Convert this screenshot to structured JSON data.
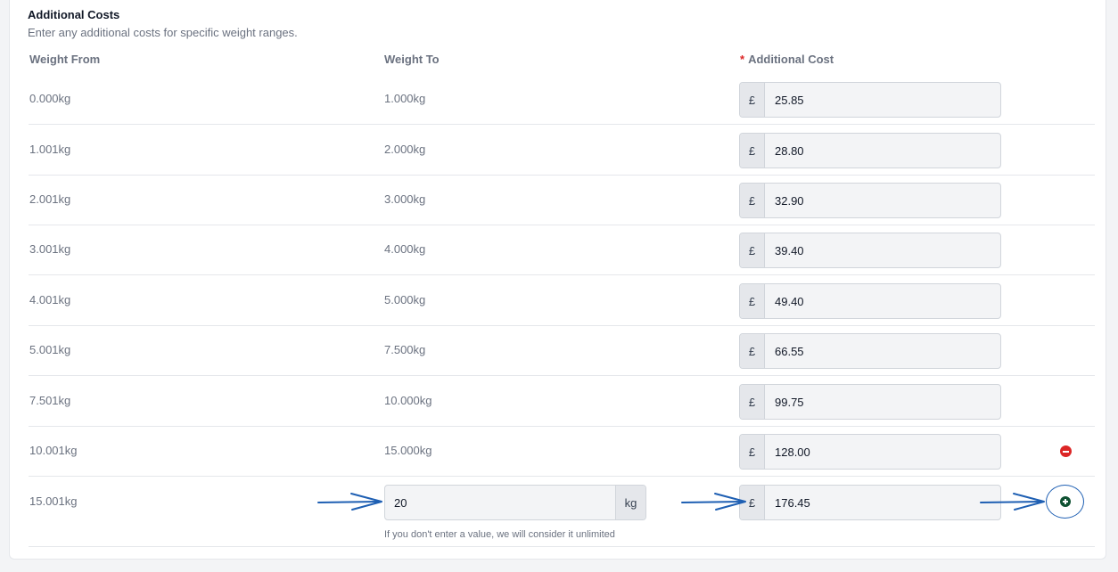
{
  "section": {
    "title": "Additional Costs",
    "subtitle": "Enter any additional costs for specific weight ranges."
  },
  "columns": {
    "weight_from": "Weight From",
    "weight_to": "Weight To",
    "required_mark": "*",
    "additional_cost": "Additional Cost"
  },
  "currency_symbol": "£",
  "rows": [
    {
      "from": "0.000kg",
      "to": "1.000kg",
      "cost": "25.85"
    },
    {
      "from": "1.001kg",
      "to": "2.000kg",
      "cost": "28.80"
    },
    {
      "from": "2.001kg",
      "to": "3.000kg",
      "cost": "32.90"
    },
    {
      "from": "3.001kg",
      "to": "4.000kg",
      "cost": "39.40"
    },
    {
      "from": "4.001kg",
      "to": "5.000kg",
      "cost": "49.40"
    },
    {
      "from": "5.001kg",
      "to": "7.500kg",
      "cost": "66.55"
    },
    {
      "from": "7.501kg",
      "to": "10.000kg",
      "cost": "99.75"
    },
    {
      "from": "10.001kg",
      "to": "15.000kg",
      "cost": "128.00"
    }
  ],
  "new_row": {
    "from": "15.001kg",
    "to_value": "20",
    "to_unit": "kg",
    "cost": "176.45",
    "hint": "If you don't enter a value, we will consider it unlimited"
  },
  "icons": {
    "remove": "minus-circle-icon",
    "add": "plus-circle-icon",
    "annotation": "arrow-right-icon"
  },
  "colors": {
    "required": "#dc2626",
    "remove": "#dc2626",
    "add": "#0f5132",
    "annotation": "#1e5fb3"
  }
}
